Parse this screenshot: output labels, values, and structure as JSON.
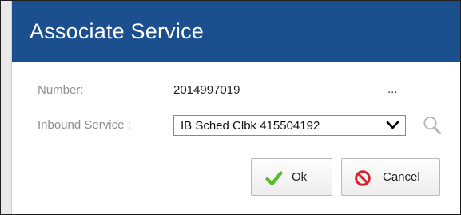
{
  "dialog": {
    "title": "Associate Service"
  },
  "fields": {
    "number": {
      "label": "Number:",
      "value": "2014997019",
      "more_link": "..."
    },
    "inbound_service": {
      "label": "Inbound Service :",
      "selected": "IB Sched Clbk 415504192"
    }
  },
  "buttons": {
    "ok_label": "Ok",
    "cancel_label": "Cancel"
  },
  "colors": {
    "title_bar": "#1c4f8d",
    "ok_check": "#5cb82e",
    "cancel_icon": "#d9212b",
    "label_text": "#8f8f8f"
  },
  "icons": {
    "dropdown": "chevron-down-icon",
    "lookup": "search-icon",
    "ok": "checkmark-icon",
    "cancel": "prohibited-icon"
  }
}
